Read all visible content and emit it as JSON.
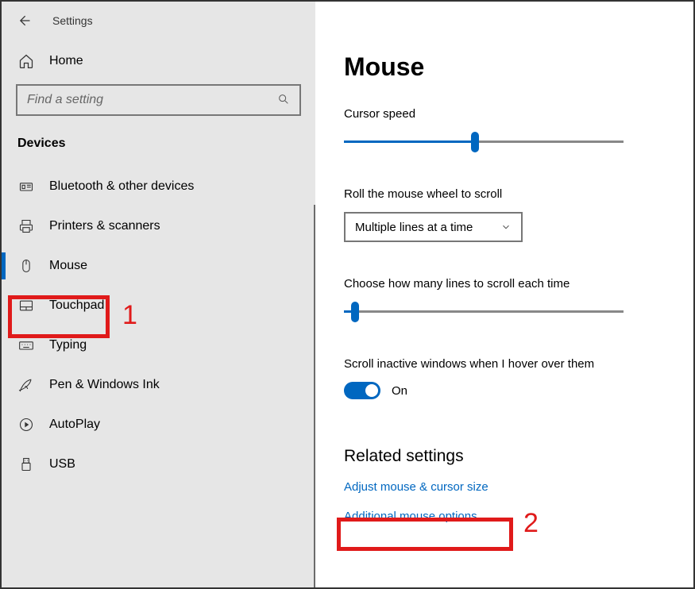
{
  "app": {
    "title": "Settings"
  },
  "sidebar": {
    "home": "Home",
    "search_placeholder": "Find a setting",
    "category": "Devices",
    "items": [
      {
        "label": "Bluetooth & other devices"
      },
      {
        "label": "Printers & scanners"
      },
      {
        "label": "Mouse"
      },
      {
        "label": "Touchpad"
      },
      {
        "label": "Typing"
      },
      {
        "label": "Pen & Windows Ink"
      },
      {
        "label": "AutoPlay"
      },
      {
        "label": "USB"
      }
    ]
  },
  "page": {
    "title": "Mouse",
    "cursor_speed_label": "Cursor speed",
    "cursor_speed_pct": 47,
    "roll_label": "Roll the mouse wheel to scroll",
    "roll_value": "Multiple lines at a time",
    "lines_label": "Choose how many lines to scroll each time",
    "lines_pct": 4,
    "inactive_label": "Scroll inactive windows when I hover over them",
    "inactive_state": "On",
    "related_heading": "Related settings",
    "link1": "Adjust mouse & cursor size",
    "link2": "Additional mouse options"
  },
  "annotations": {
    "n1": "1",
    "n2": "2"
  }
}
